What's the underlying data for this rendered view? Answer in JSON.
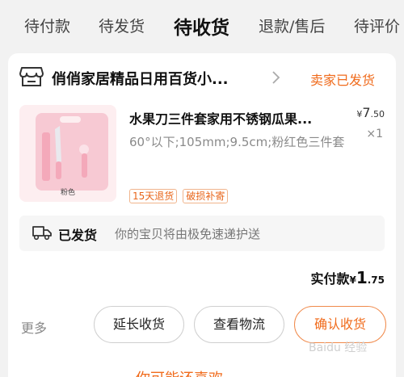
{
  "tabs": [
    {
      "label": "待付款"
    },
    {
      "label": "待发货"
    },
    {
      "label": "待收货"
    },
    {
      "label": "退款/售后"
    },
    {
      "label": "待评价"
    }
  ],
  "active_tab": "待收货",
  "order": {
    "shop_name": "俏俏家居精品日用百货小...",
    "status": "卖家已发货",
    "product": {
      "title": "水果刀三件套家用不锈钢瓜果...",
      "spec": "60°以下;105mm;9.5cm;粉红色三件套",
      "thumb_label": "粉色",
      "price_currency": "¥",
      "price_int": "7",
      "price_dec": ".50",
      "qty": "×1",
      "tags": [
        "15天退货",
        "破损补寄"
      ]
    },
    "logistics": {
      "status": "已发货",
      "desc": "你的宝贝将由极免速递护送"
    },
    "payment": {
      "label": "实付款",
      "currency": "¥",
      "int": "1",
      "dec": ".75"
    },
    "actions": {
      "more": "更多",
      "extend": "延长收货",
      "view_logistics": "查看物流",
      "confirm": "确认收货"
    }
  },
  "bottom_hint": "你可能还喜欢",
  "watermark": "Baidu 经验",
  "colors": {
    "accent": "#f06b1c",
    "background": "#f2f2f2",
    "card": "#ffffff",
    "thumb_bg": "#fdeef0"
  },
  "icons": [
    "shop-icon",
    "chevron-right-icon",
    "truck-icon"
  ]
}
